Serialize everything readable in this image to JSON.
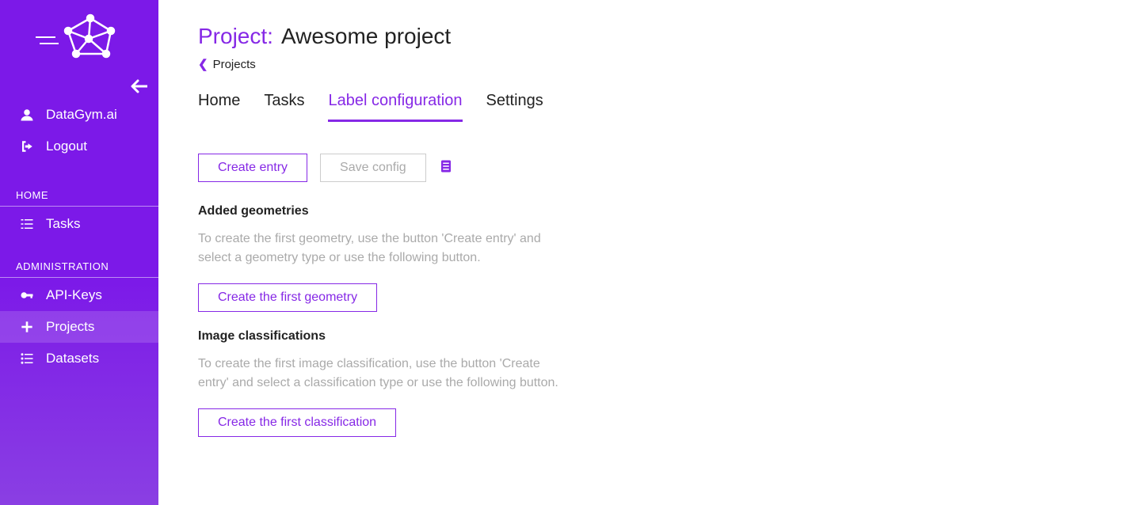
{
  "sidebar": {
    "brand": "DataGym.ai",
    "logout": "Logout",
    "sections": {
      "home": {
        "header": "HOME",
        "tasks": "Tasks"
      },
      "admin": {
        "header": "ADMINISTRATION",
        "apikeys": "API-Keys",
        "projects": "Projects",
        "datasets": "Datasets"
      }
    }
  },
  "header": {
    "prefix": "Project:",
    "name": "Awesome project",
    "breadcrumb": "Projects"
  },
  "tabs": {
    "home": "Home",
    "tasks": "Tasks",
    "label_config": "Label configuration",
    "settings": "Settings"
  },
  "toolbar": {
    "create_entry": "Create entry",
    "save_config": "Save config"
  },
  "geom": {
    "title": "Added geometries",
    "help": "To create the first geometry, use the button 'Create entry' and select a geometry type or use the following button.",
    "cta": "Create the first geometry"
  },
  "classif": {
    "title": "Image classifications",
    "help": "To create the first image classification, use the button 'Create entry' and select a classification type or use the following button.",
    "cta": "Create the first classification"
  }
}
